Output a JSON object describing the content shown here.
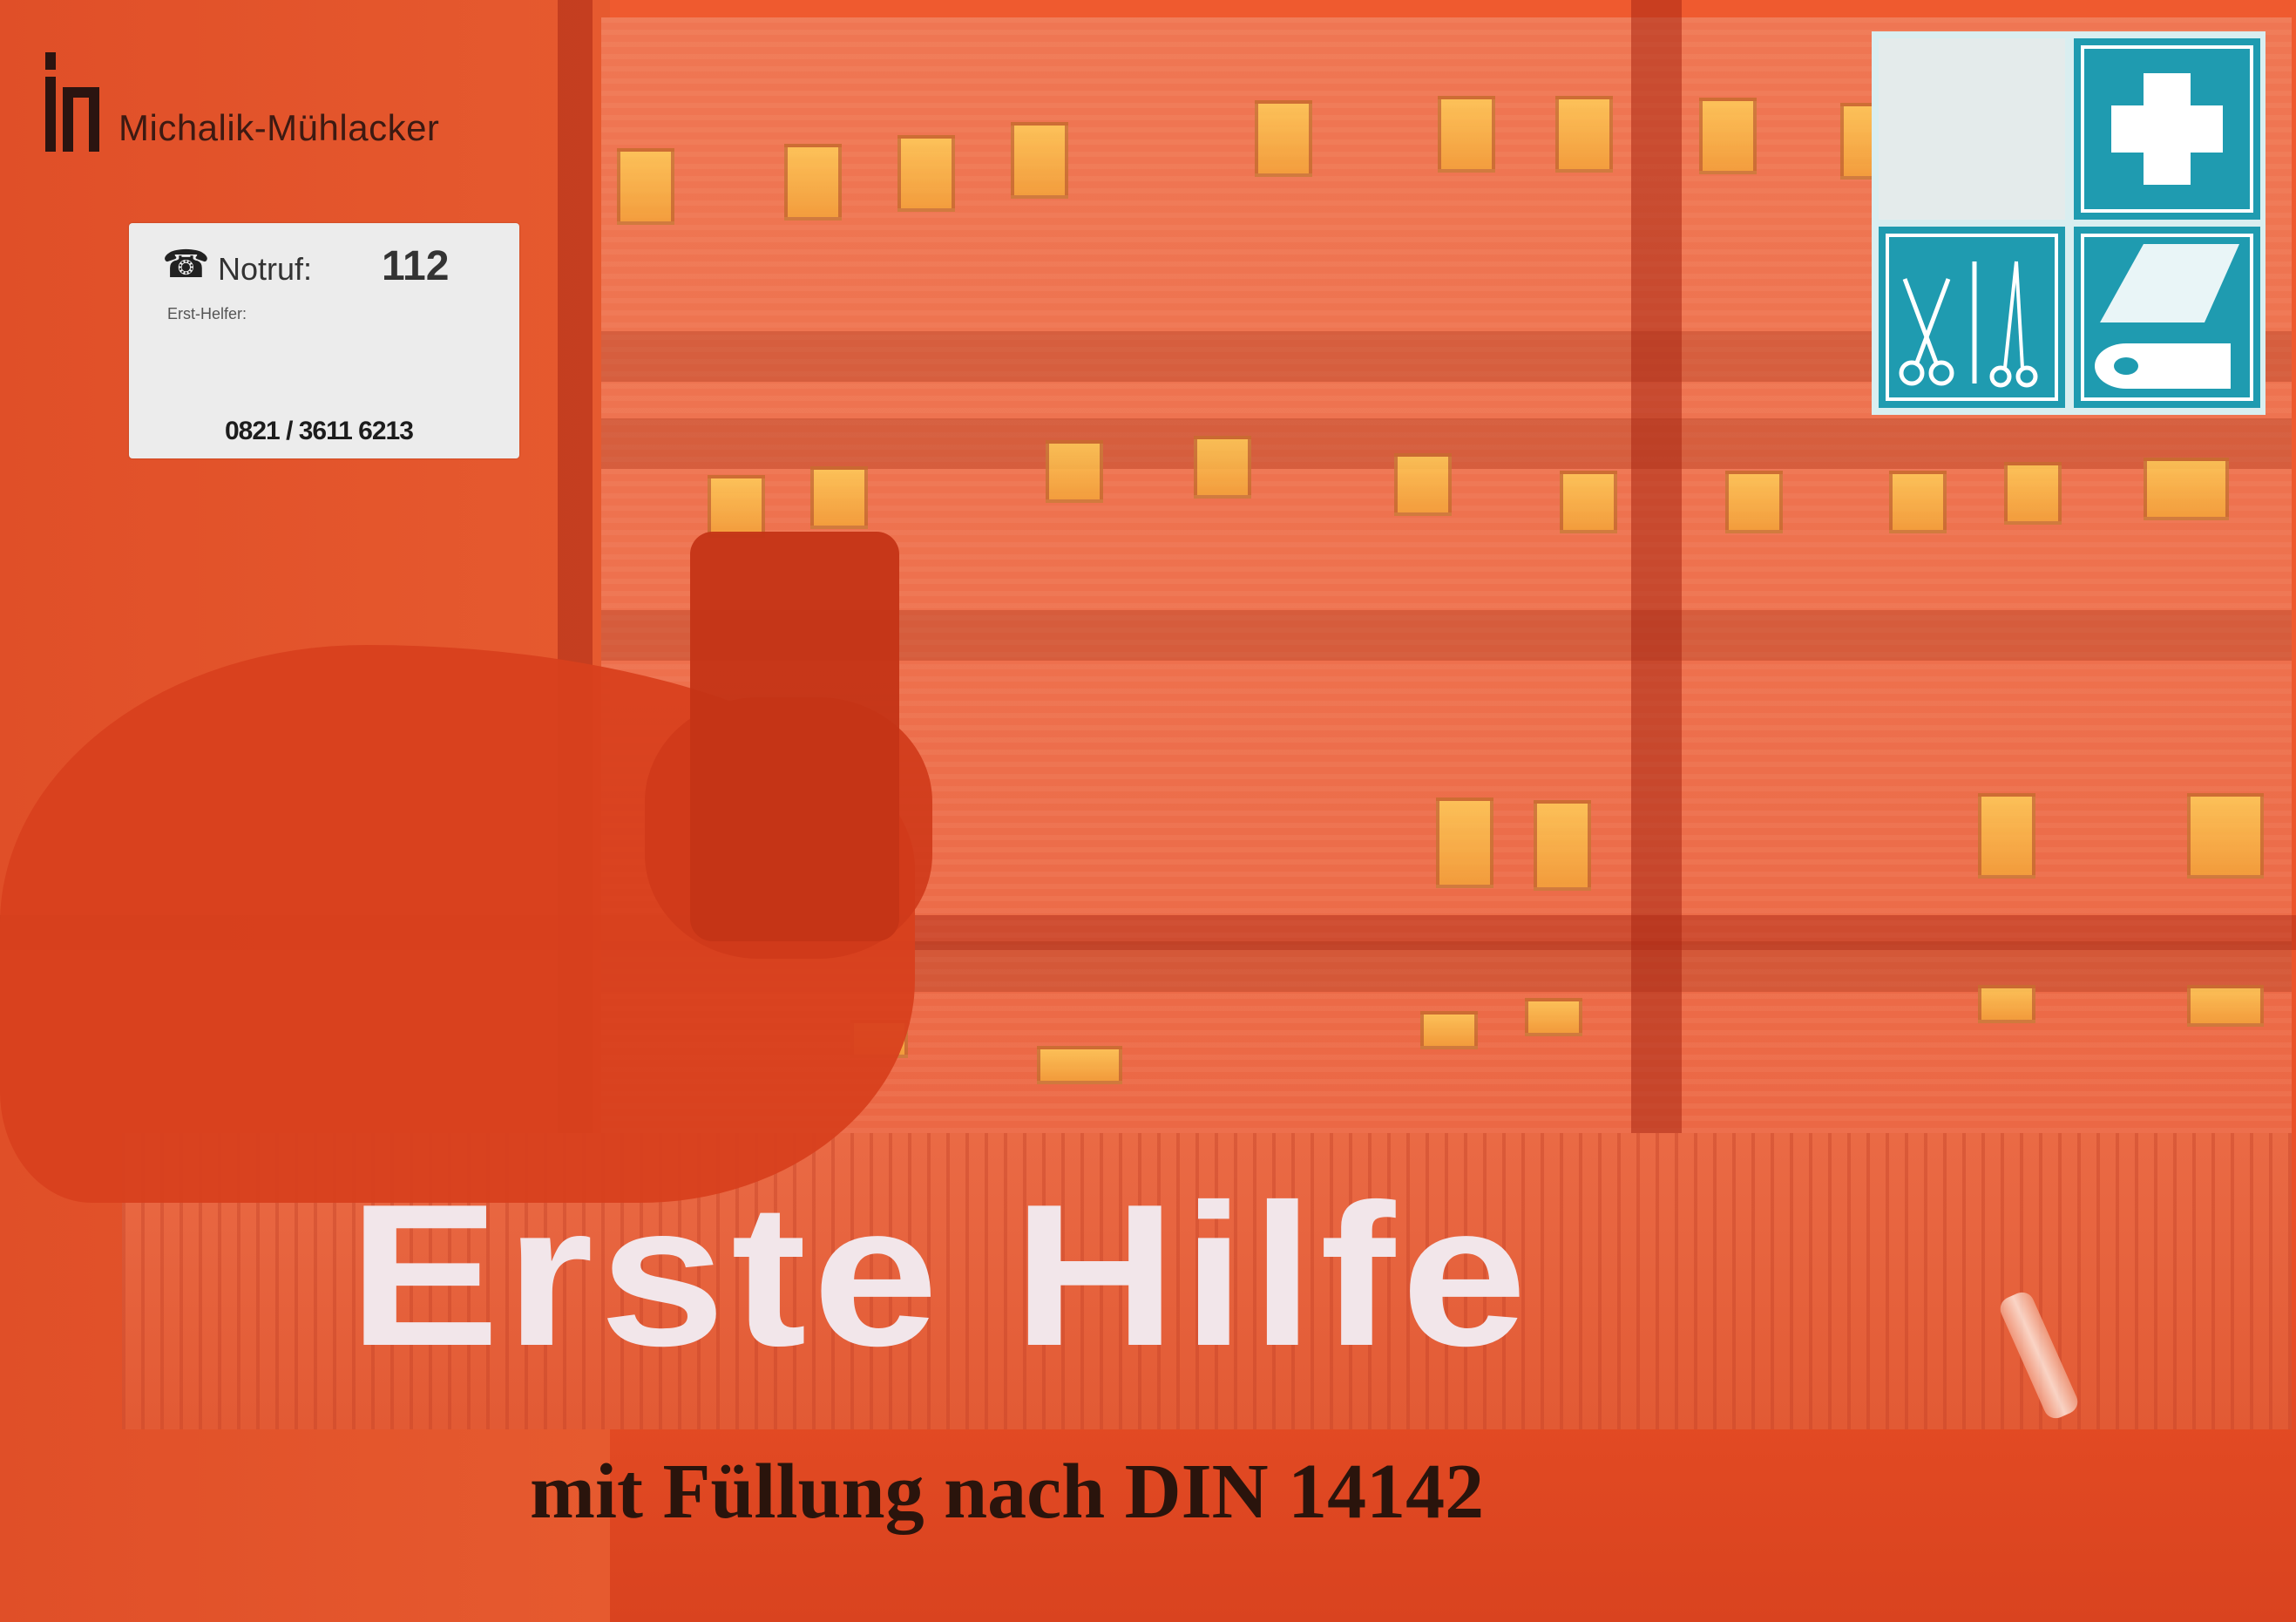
{
  "brand": {
    "name": "Michalik-Mühlacker"
  },
  "sticker": {
    "label": "Notruf:",
    "number": "112",
    "helper_heading": "Erst-Helfer:",
    "phone_number": "0821 / 3611 6213"
  },
  "signs": {
    "top_left": "blank",
    "top_right": "first-aid-cross-icon",
    "bottom_left": "scissors-instruments-icon",
    "bottom_right": "bandage-roll-icon"
  },
  "title": "Erste Hilfe",
  "subtitle": "mit Füllung nach DIN 14142",
  "colors": {
    "case": "#ee5a2e",
    "title_text": "#f2e6ea",
    "subtitle_text": "#2a140c",
    "sign_blue": "#1f9bb0",
    "window_glow": "#ffce5a"
  }
}
